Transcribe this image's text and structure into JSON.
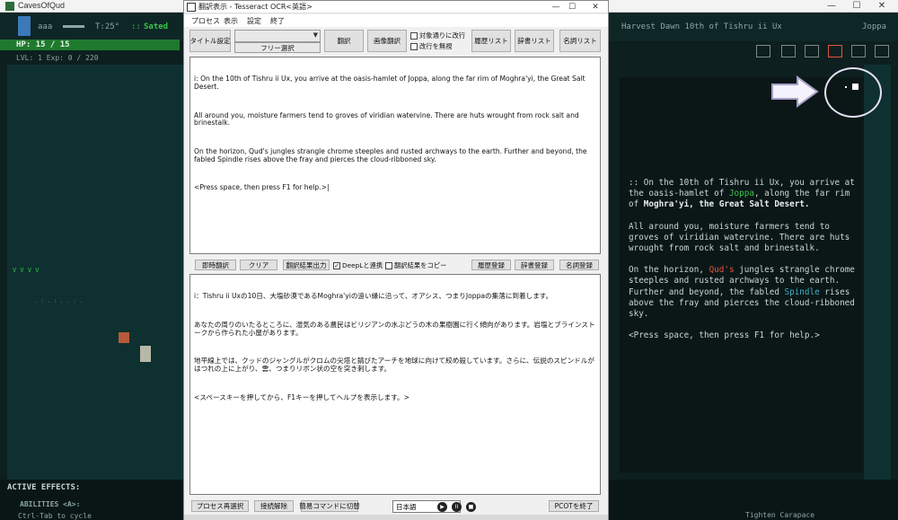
{
  "game": {
    "window_title": "CavesOfQud",
    "player_name": "aaa",
    "temperature": "T:25°",
    "status": "Sated",
    "status_right": "Harvest Dawn 10th of Tishru ii Ux",
    "location": "Joppa",
    "hp": "HP: 15 / 15",
    "level": "LVL: 1 Exp: 0 / 220",
    "active_effects": "ACTIVE EFFECTS:",
    "abilities": "ABILITIES <A>:",
    "ctrl_tab": "Ctrl-Tab to cycle",
    "tighten": "Tighten Carapace",
    "message_log": {
      "p1_a": ":: On the 10th of Tishru ii Ux, you arrive at the oasis-hamlet of ",
      "p1_joppa": "Joppa",
      "p1_b": ", along the far rim of ",
      "p1_moghra": "Moghra'yi, the Great Salt Desert.",
      "p2": "All around you, moisture farmers tend to groves of viridian watervine. There are huts wrought from rock salt and brinestalk.",
      "p3_a": "On the horizon, ",
      "p3_qud": "Qud's",
      "p3_b": " jungles strangle chrome steeples and rusted archways to the earth. Further and beyond, the fabled ",
      "p3_spindle": "Spindle",
      "p3_c": " rises above the fray and pierces the cloud-ribboned sky.",
      "p4": "<Press space, then press F1 for help.>"
    },
    "colors": {
      "hp_bar": "#1f7a2e",
      "joppa": "#3bc44b",
      "qud": "#e0553a",
      "spindle": "#3fb0c6"
    }
  },
  "ocr": {
    "window_title": "翻訳表示 - Tesseract OCR<英語>",
    "menu": [
      "プロセス",
      "表示",
      "設定",
      "終了"
    ],
    "toolbar": {
      "title_settings": "タイトル設定",
      "free_select": "フリー選択",
      "translate": "翻訳",
      "image_translate": "画像翻訳",
      "chk_line_break": "対象通りに改行",
      "chk_ignore_break": "改行を無視",
      "history": "履歴リスト",
      "dictionary": "辞書リスト",
      "nouns": "名詞リスト"
    },
    "source_text": {
      "p1": "i: On the 10th of Tishru ii Ux, you arrive at the oasis-hamlet of Joppa, along the far rim of Moghra'yi, the Great Salt Desert.",
      "p2": "All around you, moisture farmers tend to groves of viridian watervine. There are huts wrought from rock salt and brinestalk.",
      "p3": "On the horizon, Qud's jungles strangle chrome steeples and rusted archways to the earth. Further and beyond, the fabled Spindle rises above the fray and pierces the cloud-ribboned sky.",
      "p4": "<Press space, then press F1 for help.>|"
    },
    "midbar": {
      "instant": "即時翻訳",
      "clear": "クリア",
      "output": "翻訳結果出力",
      "chk_deepl": "DeepLと連携",
      "chk_copy": "翻訳結果をコピー",
      "history_reg": "履歴登録",
      "dict_reg": "辞書登録",
      "noun_reg": "名詞登録"
    },
    "result_text": {
      "p1": "i：Tishru ii Uxの10日、大塩砂漠であるMoghra'yiの遠い縁に沿って、オアシス、つまりJoppaの集落に到着します。",
      "p2": "あなたの周りのいたるところに、湿気のある農民はビリジアンの水ぶどうの木の果樹園に行く傾向があります。岩塩とブラインストークから作られた小屋があります。",
      "p3": "地平線上では、クッドのジャングルがクロムの尖塔と錆びたアーチを地球に向けて絞め殺しています。さらに、伝説のスピンドルがはつれの上に上がり、雲、つまりリボン状の空を突き刺します。",
      "p4": "<スペースキーを押してから、F1キーを押してヘルプを表示します。>"
    },
    "bottombar": {
      "reselect": "プロセス再選択",
      "disconnect": "接続解除",
      "simple": "簡易コマンドに切替",
      "language": "日本語",
      "exit": "PCOTを終了"
    }
  }
}
